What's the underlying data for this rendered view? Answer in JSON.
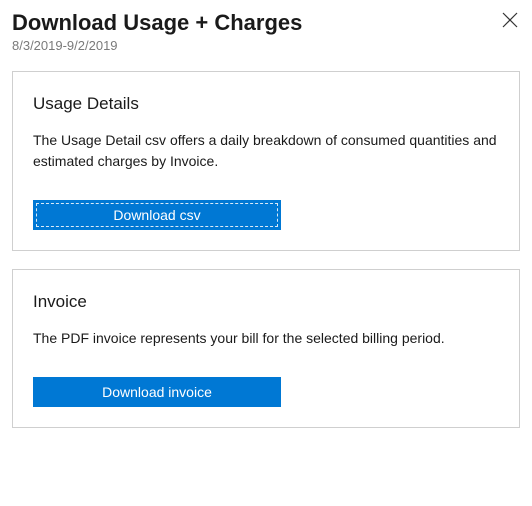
{
  "header": {
    "title": "Download Usage + Charges",
    "date_range": "8/3/2019-9/2/2019"
  },
  "cards": {
    "usage": {
      "title": "Usage Details",
      "description": "The Usage Detail csv offers a daily breakdown of consumed quantities and estimated charges by Invoice.",
      "button_label": "Download csv"
    },
    "invoice": {
      "title": "Invoice",
      "description": "The PDF invoice represents your bill for the selected billing period.",
      "button_label": "Download invoice"
    }
  }
}
